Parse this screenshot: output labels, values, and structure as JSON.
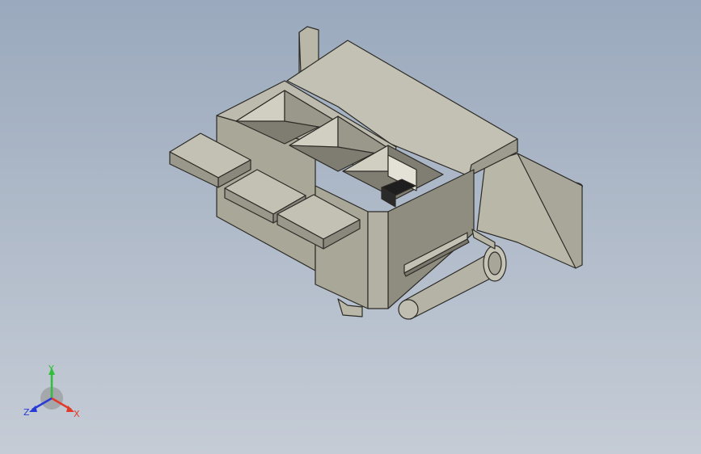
{
  "viewport": {
    "background_top": "#9aa9bd",
    "background_bottom": "#c5ccd6"
  },
  "model": {
    "body_color": "#b9b7a7",
    "top_color": "#c3c1b3",
    "shadow_color": "#8f8d80",
    "dark_color": "#7a786c",
    "edge_color": "#2c2b26",
    "black_part_color": "#1e1e1e"
  },
  "triad": {
    "x_label": "X",
    "y_label": "Y",
    "z_label": "Z",
    "x_color": "#e23a2a",
    "y_color": "#2fbf3a",
    "z_color": "#2a3ad6"
  }
}
